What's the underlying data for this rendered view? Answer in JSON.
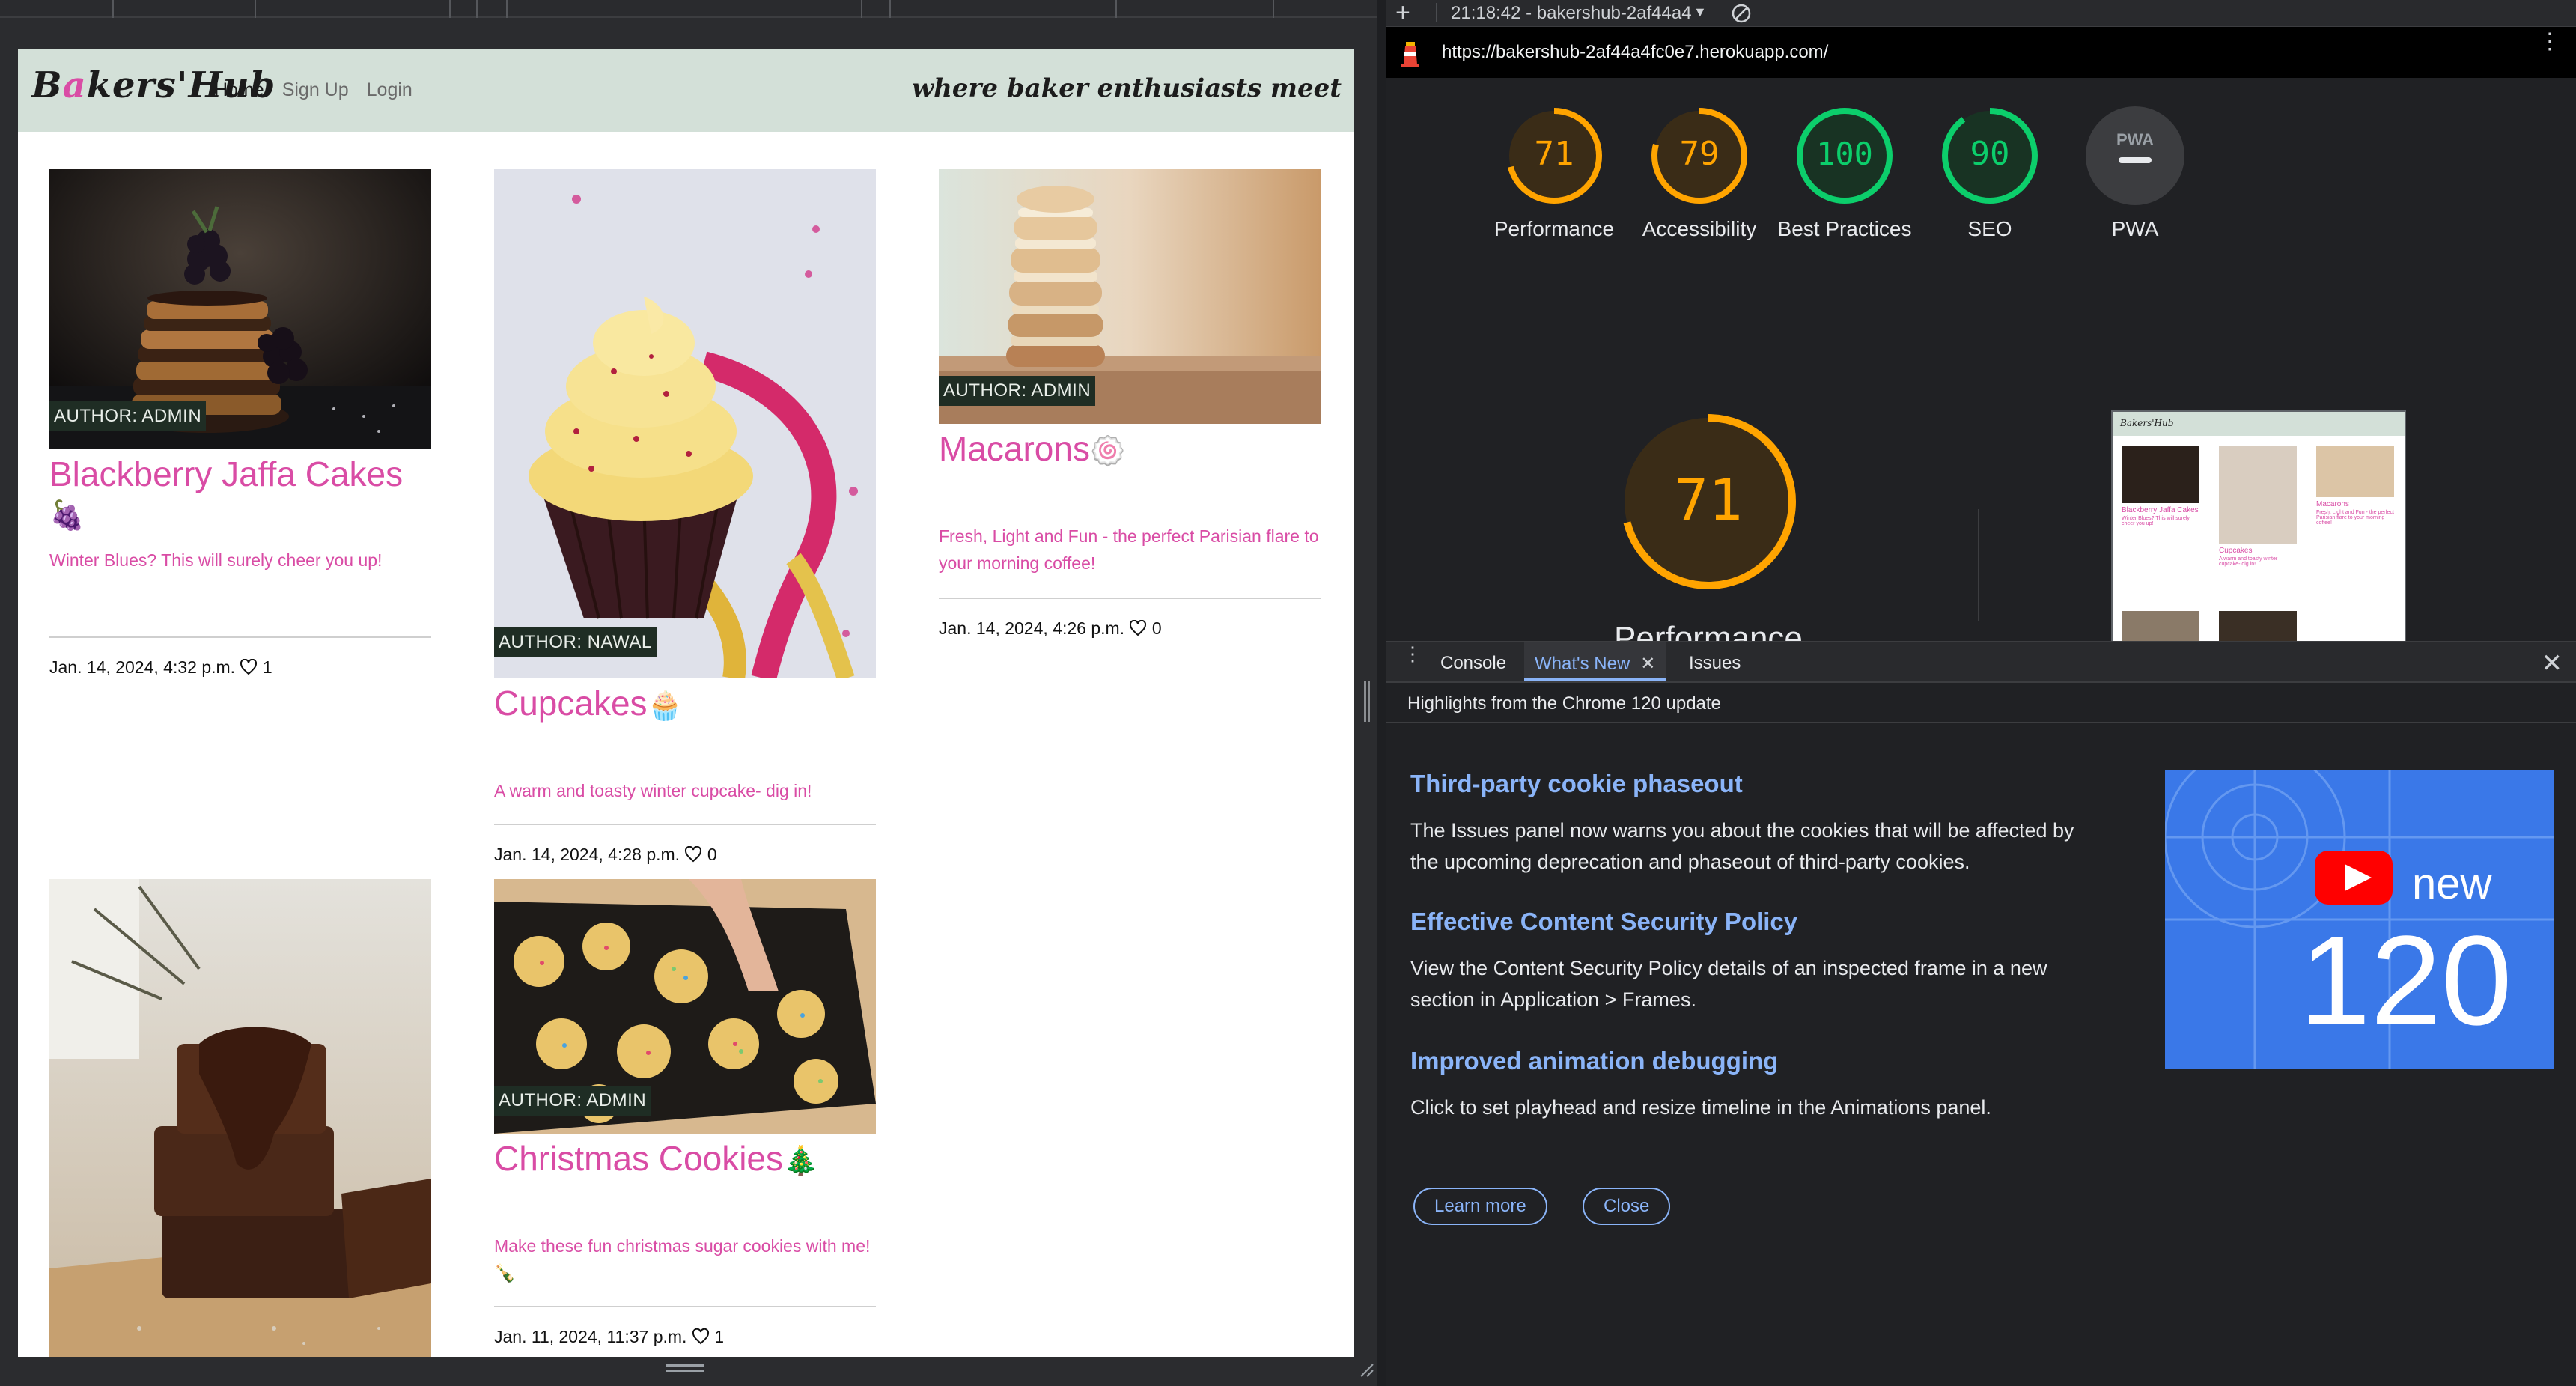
{
  "site": {
    "brand_prefix": "B",
    "brand_pink": "a",
    "brand_suffix": "kers'Hub",
    "nav": [
      {
        "label": "Home",
        "active": true
      },
      {
        "label": "Sign Up",
        "active": false
      },
      {
        "label": "Login",
        "active": false
      }
    ],
    "tagline": "where baker enthusiasts meet",
    "posts": [
      {
        "author": "AUTHOR: ADMIN",
        "title": "Blackberry Jaffa Cakes",
        "emoji": "🍇",
        "excerpt": "Winter Blues? This will surely cheer you up!",
        "date": "Jan. 14, 2024, 4:32 p.m.",
        "likes": "1"
      },
      {
        "author": "AUTHOR: NAWAL",
        "title": "Cupcakes",
        "emoji": "🧁",
        "excerpt": "A warm and toasty winter cupcake- dig in!",
        "date": "Jan. 14, 2024, 4:28 p.m.",
        "likes": "0"
      },
      {
        "author": "AUTHOR: ADMIN",
        "title": "Macarons",
        "emoji": "🍥",
        "excerpt": "Fresh, Light and Fun - the perfect Parisian flare to your morning coffee!",
        "date": "Jan. 14, 2024, 4:26 p.m.",
        "likes": "0"
      },
      {
        "author": "AUTHOR: ADMIN",
        "title": "Christmas Cookies",
        "emoji": "🎄",
        "excerpt": "Make these fun christmas sugar cookies with me!🍾",
        "date": "Jan. 11, 2024, 11:37 p.m.",
        "likes": "1"
      }
    ],
    "colors": {
      "accent": "#d94ca5",
      "navbar": "#d3e0d8",
      "author_badge": "#1f2d24"
    }
  },
  "devtools": {
    "report_title": "21:18:42 - bakershub-2af44a4",
    "url": "https://bakershub-2af44a4fc0e7.herokuapp.com/",
    "scores": [
      {
        "label": "Performance",
        "value": 71,
        "display": "71",
        "color": "#ffa400"
      },
      {
        "label": "Accessibility",
        "value": 79,
        "display": "79",
        "color": "#ffa400"
      },
      {
        "label": "Best Practices",
        "value": 100,
        "display": "100",
        "color": "#0cce6b"
      },
      {
        "label": "SEO",
        "value": 90,
        "display": "90",
        "color": "#0cce6b"
      },
      {
        "label": "PWA",
        "value": null,
        "display": "PWA",
        "color": "#5f6368"
      }
    ],
    "big_score": {
      "value": 71,
      "display": "71",
      "label": "Performance"
    },
    "drawer": {
      "tabs": [
        {
          "label": "Console",
          "active": false
        },
        {
          "label": "What's New",
          "active": true
        },
        {
          "label": "Issues",
          "active": false
        }
      ],
      "subheading": "Highlights from the Chrome 120 update",
      "items": [
        {
          "heading": "Third-party cookie phaseout",
          "body": "The Issues panel now warns you about the cookies that will be affected by the upcoming deprecation and phaseout of third-party cookies."
        },
        {
          "heading": "Effective Content Security Policy",
          "body": "View the Content Security Policy details of an inspected frame in a new section in Application > Frames."
        },
        {
          "heading": "Improved animation debugging",
          "body": "Click to set playhead and resize timeline in the Animations panel."
        }
      ],
      "promo_word": "new",
      "promo_number": "120",
      "learn_more": "Learn more",
      "close": "Close"
    }
  }
}
